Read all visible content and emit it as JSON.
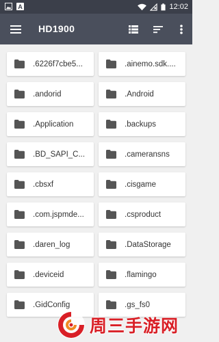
{
  "status_bar": {
    "time": "12:02",
    "icons": [
      "image-icon",
      "a-icon",
      "wifi-icon",
      "signal-off-icon",
      "battery-icon"
    ]
  },
  "app_bar": {
    "title": "HD1900",
    "menu_icon": "hamburger-menu-icon",
    "actions": [
      "list-view-icon",
      "sort-icon",
      "more-vert-icon"
    ]
  },
  "folders": [
    ".6226f7cbe5...",
    ".ainemo.sdk....",
    ".andorid",
    ".Android",
    ".Application",
    ".backups",
    ".BD_SAPI_C...",
    ".cameransns",
    ".cbsxf",
    ".cisgame",
    ".com.jspmde...",
    ".csproduct",
    ".daren_log",
    ".DataStorage",
    ".deviceid",
    ".flamingo",
    ".GidConfig",
    ".gs_fs0"
  ],
  "watermark": {
    "text": "周三手游网"
  },
  "colors": {
    "status_bar": "#3b3f4a",
    "app_bar": "#4a4f5c",
    "background": "#f0f0f0",
    "folder_icon": "#555555",
    "watermark": "#d91f26"
  }
}
